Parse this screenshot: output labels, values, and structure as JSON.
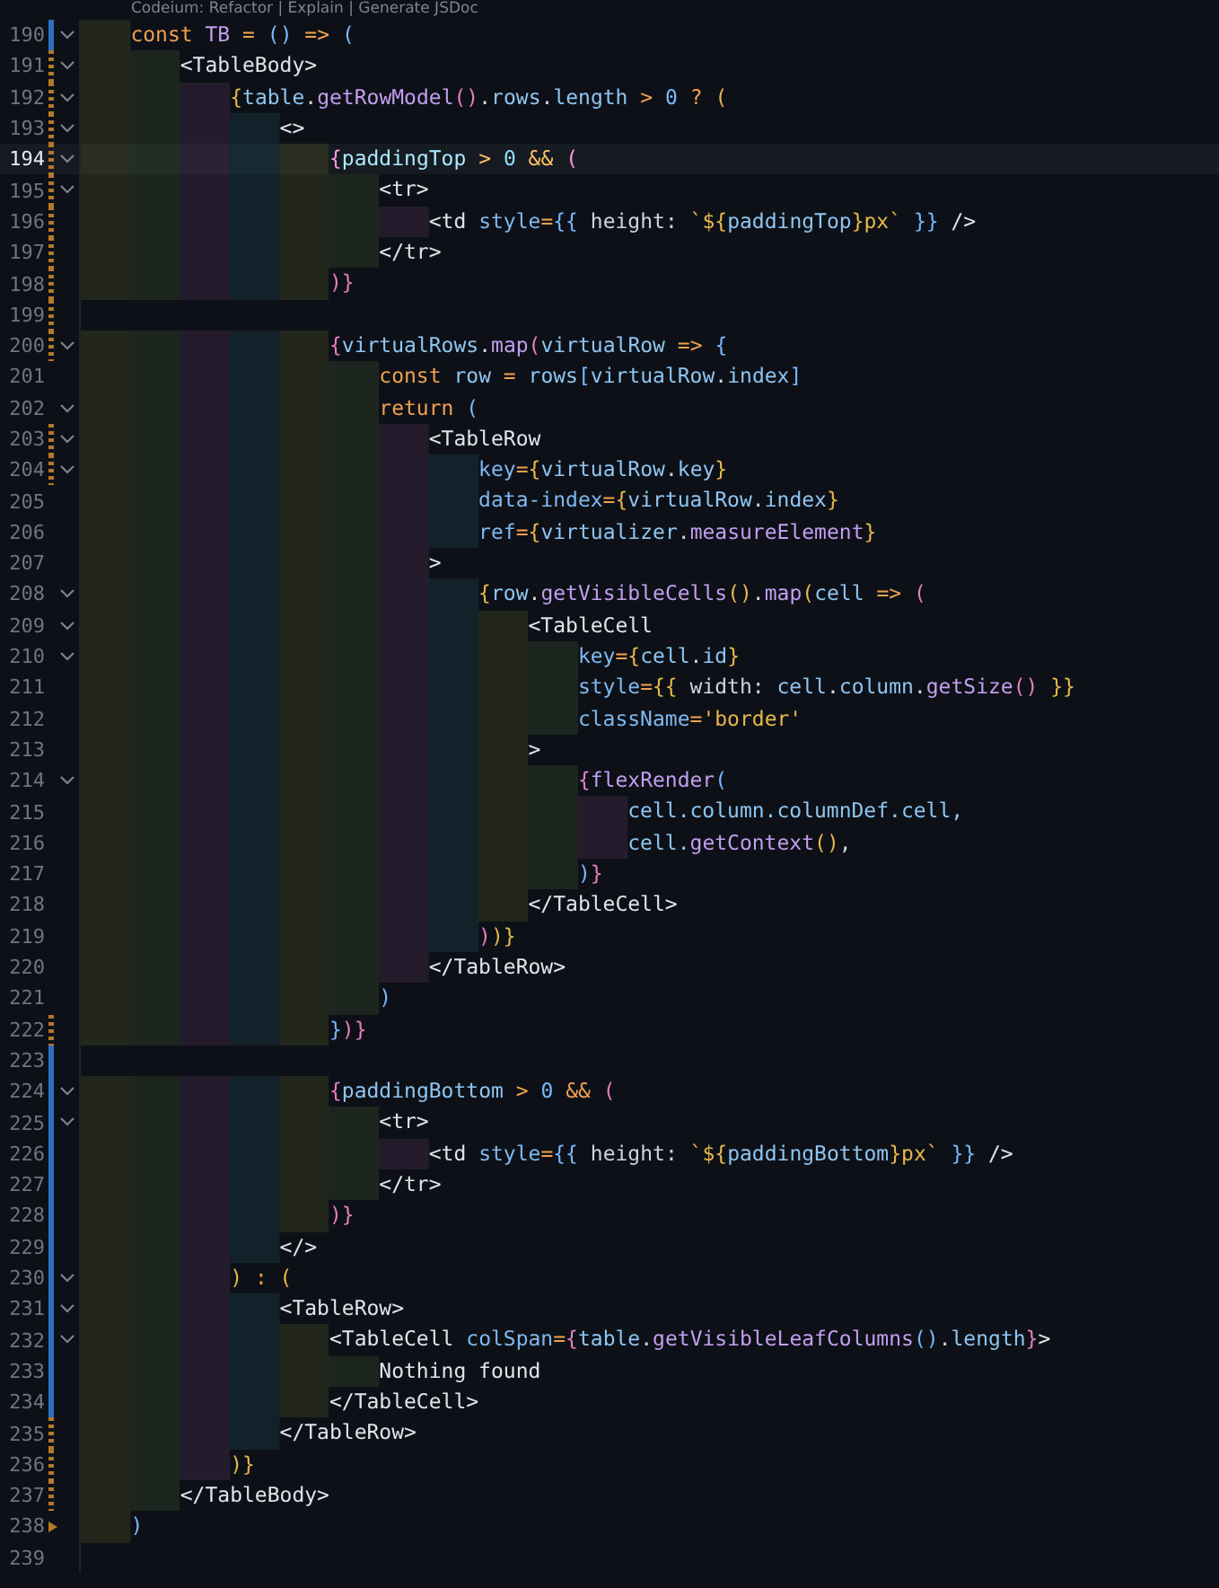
{
  "code_lens": "Codeium: Refactor | Explain | Generate JSDoc",
  "lines": [
    {
      "number": "190",
      "current": false,
      "foldable": true,
      "kind": "modified",
      "tokens": [
        {
          "kind": "kw",
          "text": "    const "
        },
        {
          "kind": "fn",
          "text": "TB"
        },
        {
          "kind": "op",
          "text": " = "
        },
        {
          "kind": "b3",
          "text": "()"
        },
        {
          "kind": "op",
          "text": " => "
        },
        {
          "kind": "b3",
          "text": "("
        }
      ]
    },
    {
      "number": "191",
      "current": false,
      "foldable": true,
      "kind": "changed",
      "tokens": [
        {
          "kind": "tag",
          "text": "        <TableBody>"
        }
      ]
    },
    {
      "number": "192",
      "current": false,
      "foldable": true,
      "kind": "changed",
      "tokens": [
        {
          "kind": "b1",
          "text": "            {"
        },
        {
          "kind": "id",
          "text": "table"
        },
        {
          "kind": "punc",
          "text": "."
        },
        {
          "kind": "fn",
          "text": "getRowModel"
        },
        {
          "kind": "b2",
          "text": "()"
        },
        {
          "kind": "punc",
          "text": "."
        },
        {
          "kind": "id",
          "text": "rows"
        },
        {
          "kind": "punc",
          "text": "."
        },
        {
          "kind": "id",
          "text": "length"
        },
        {
          "kind": "op",
          "text": " > "
        },
        {
          "kind": "num",
          "text": "0"
        },
        {
          "kind": "op",
          "text": " ? "
        },
        {
          "kind": "b1",
          "text": "("
        }
      ]
    },
    {
      "number": "193",
      "current": false,
      "foldable": true,
      "kind": "changed",
      "tokens": [
        {
          "kind": "tag",
          "text": "                <>"
        }
      ]
    },
    {
      "number": "194",
      "current": true,
      "foldable": true,
      "kind": "changed",
      "tokens": [
        {
          "kind": "b2",
          "text": "                    {"
        },
        {
          "kind": "id",
          "text": "paddingTop"
        },
        {
          "kind": "op",
          "text": " > "
        },
        {
          "kind": "num",
          "text": "0"
        },
        {
          "kind": "op",
          "text": " && "
        },
        {
          "kind": "b2",
          "text": "("
        }
      ]
    },
    {
      "number": "195",
      "current": false,
      "foldable": true,
      "kind": "changed",
      "tokens": [
        {
          "kind": "tag",
          "text": "                        <tr>"
        }
      ]
    },
    {
      "number": "196",
      "current": false,
      "foldable": false,
      "kind": "changed",
      "tokens": [
        {
          "kind": "tag",
          "text": "                            <td "
        },
        {
          "kind": "attr",
          "text": "style"
        },
        {
          "kind": "op",
          "text": "="
        },
        {
          "kind": "b3",
          "text": "{{"
        },
        {
          "kind": "punc",
          "text": " height: "
        },
        {
          "kind": "str",
          "text": "`${"
        },
        {
          "kind": "id",
          "text": "paddingTop"
        },
        {
          "kind": "str",
          "text": "}px`"
        },
        {
          "kind": "b3",
          "text": " }}"
        },
        {
          "kind": "tag",
          "text": " />"
        }
      ]
    },
    {
      "number": "197",
      "current": false,
      "foldable": false,
      "kind": "changed",
      "tokens": [
        {
          "kind": "tag",
          "text": "                        </tr>"
        }
      ]
    },
    {
      "number": "198",
      "current": false,
      "foldable": false,
      "kind": "changed",
      "tokens": [
        {
          "kind": "b2",
          "text": "                    )}"
        }
      ]
    },
    {
      "number": "199",
      "current": false,
      "foldable": false,
      "kind": "changed"
    },
    {
      "number": "200",
      "current": false,
      "foldable": true,
      "kind": "changed",
      "tokens": [
        {
          "kind": "b2",
          "text": "                    {"
        },
        {
          "kind": "id",
          "text": "virtualRows"
        },
        {
          "kind": "punc",
          "text": "."
        },
        {
          "kind": "fn",
          "text": "map"
        },
        {
          "kind": "b2",
          "text": "("
        },
        {
          "kind": "id",
          "text": "virtualRow"
        },
        {
          "kind": "op",
          "text": " => "
        },
        {
          "kind": "b3",
          "text": "{"
        }
      ]
    },
    {
      "number": "201",
      "current": false,
      "foldable": false,
      "kind": "plain",
      "tokens": [
        {
          "kind": "kw",
          "text": "                        const "
        },
        {
          "kind": "id",
          "text": "row"
        },
        {
          "kind": "op",
          "text": " = "
        },
        {
          "kind": "id",
          "text": "rows"
        },
        {
          "kind": "b3",
          "text": "["
        },
        {
          "kind": "id",
          "text": "virtualRow"
        },
        {
          "kind": "punc",
          "text": "."
        },
        {
          "kind": "id",
          "text": "index"
        },
        {
          "kind": "b3",
          "text": "]"
        }
      ]
    },
    {
      "number": "202",
      "current": false,
      "foldable": true,
      "kind": "plain",
      "tokens": [
        {
          "kind": "kw",
          "text": "                        return "
        },
        {
          "kind": "b3",
          "text": "("
        }
      ]
    },
    {
      "number": "203",
      "current": false,
      "foldable": true,
      "kind": "changed",
      "tokens": [
        {
          "kind": "tag",
          "text": "                            <TableRow"
        }
      ]
    },
    {
      "number": "204",
      "current": false,
      "foldable": true,
      "kind": "changed",
      "tokens": [
        {
          "kind": "attr",
          "text": "                                key"
        },
        {
          "kind": "op",
          "text": "="
        },
        {
          "kind": "b1",
          "text": "{"
        },
        {
          "kind": "id",
          "text": "virtualRow"
        },
        {
          "kind": "punc",
          "text": "."
        },
        {
          "kind": "id",
          "text": "key"
        },
        {
          "kind": "b1",
          "text": "}"
        }
      ]
    },
    {
      "number": "205",
      "current": false,
      "foldable": false,
      "kind": "plain",
      "tokens": [
        {
          "kind": "attr",
          "text": "                                data-index"
        },
        {
          "kind": "op",
          "text": "="
        },
        {
          "kind": "b1",
          "text": "{"
        },
        {
          "kind": "id",
          "text": "virtualRow"
        },
        {
          "kind": "punc",
          "text": "."
        },
        {
          "kind": "id",
          "text": "index"
        },
        {
          "kind": "b1",
          "text": "}"
        }
      ]
    },
    {
      "number": "206",
      "current": false,
      "foldable": false,
      "kind": "plain",
      "tokens": [
        {
          "kind": "attr",
          "text": "                                ref"
        },
        {
          "kind": "op",
          "text": "="
        },
        {
          "kind": "b1",
          "text": "{"
        },
        {
          "kind": "id",
          "text": "virtualizer"
        },
        {
          "kind": "punc",
          "text": "."
        },
        {
          "kind": "fn",
          "text": "measureElement"
        },
        {
          "kind": "b1",
          "text": "}"
        }
      ]
    },
    {
      "number": "207",
      "current": false,
      "foldable": false,
      "kind": "plain",
      "tokens": [
        {
          "kind": "tag",
          "text": "                            >"
        }
      ]
    },
    {
      "number": "208",
      "current": false,
      "foldable": true,
      "kind": "plain",
      "tokens": [
        {
          "kind": "b1",
          "text": "                                {"
        },
        {
          "kind": "id",
          "text": "row"
        },
        {
          "kind": "punc",
          "text": "."
        },
        {
          "kind": "fn",
          "text": "getVisibleCells"
        },
        {
          "kind": "b1",
          "text": "()"
        },
        {
          "kind": "punc",
          "text": "."
        },
        {
          "kind": "fn",
          "text": "map"
        },
        {
          "kind": "b1",
          "text": "("
        },
        {
          "kind": "id",
          "text": "cell"
        },
        {
          "kind": "op",
          "text": " => "
        },
        {
          "kind": "b2",
          "text": "("
        }
      ]
    },
    {
      "number": "209",
      "current": false,
      "foldable": true,
      "kind": "plain",
      "tokens": [
        {
          "kind": "tag",
          "text": "                                    <TableCell"
        }
      ]
    },
    {
      "number": "210",
      "current": false,
      "foldable": true,
      "kind": "plain",
      "tokens": [
        {
          "kind": "attr",
          "text": "                                        key"
        },
        {
          "kind": "op",
          "text": "="
        },
        {
          "kind": "b1",
          "text": "{"
        },
        {
          "kind": "id",
          "text": "cell"
        },
        {
          "kind": "punc",
          "text": "."
        },
        {
          "kind": "id",
          "text": "id"
        },
        {
          "kind": "b1",
          "text": "}"
        }
      ]
    },
    {
      "number": "211",
      "current": false,
      "foldable": false,
      "kind": "plain",
      "tokens": [
        {
          "kind": "attr",
          "text": "                                        style"
        },
        {
          "kind": "op",
          "text": "="
        },
        {
          "kind": "b1",
          "text": "{{"
        },
        {
          "kind": "punc",
          "text": " width: "
        },
        {
          "kind": "id",
          "text": "cell"
        },
        {
          "kind": "punc",
          "text": "."
        },
        {
          "kind": "id",
          "text": "column"
        },
        {
          "kind": "punc",
          "text": "."
        },
        {
          "kind": "fn",
          "text": "getSize"
        },
        {
          "kind": "b2",
          "text": "()"
        },
        {
          "kind": "b1",
          "text": " }}"
        }
      ]
    },
    {
      "number": "212",
      "current": false,
      "foldable": false,
      "kind": "plain",
      "tokens": [
        {
          "kind": "attr",
          "text": "                                        className"
        },
        {
          "kind": "op",
          "text": "="
        },
        {
          "kind": "str",
          "text": "'border'"
        }
      ]
    },
    {
      "number": "213",
      "current": false,
      "foldable": false,
      "kind": "plain",
      "tokens": [
        {
          "kind": "tag",
          "text": "                                    >"
        }
      ]
    },
    {
      "number": "214",
      "current": false,
      "foldable": true,
      "kind": "plain",
      "tokens": [
        {
          "kind": "b2",
          "text": "                                        {"
        },
        {
          "kind": "fn",
          "text": "flexRender"
        },
        {
          "kind": "b3",
          "text": "("
        }
      ]
    },
    {
      "number": "215",
      "current": false,
      "foldable": false,
      "kind": "plain",
      "tokens": [
        {
          "kind": "id",
          "text": "                                            cell.column.columnDef.cell,"
        }
      ]
    },
    {
      "number": "216",
      "current": false,
      "foldable": false,
      "kind": "plain",
      "tokens": [
        {
          "kind": "id",
          "text": "                                            cell."
        },
        {
          "kind": "fn",
          "text": "getContext"
        },
        {
          "kind": "b1",
          "text": "()"
        },
        {
          "kind": "punc",
          "text": ","
        }
      ]
    },
    {
      "number": "217",
      "current": false,
      "foldable": false,
      "kind": "plain",
      "tokens": [
        {
          "kind": "b3",
          "text": "                                        )"
        },
        {
          "kind": "b2",
          "text": "}"
        }
      ]
    },
    {
      "number": "218",
      "current": false,
      "foldable": false,
      "kind": "plain",
      "tokens": [
        {
          "kind": "tag",
          "text": "                                    </TableCell>"
        }
      ]
    },
    {
      "number": "219",
      "current": false,
      "foldable": false,
      "kind": "plain",
      "tokens": [
        {
          "kind": "b2",
          "text": "                                )"
        },
        {
          "kind": "b1",
          "text": ")}"
        }
      ]
    },
    {
      "number": "220",
      "current": false,
      "foldable": false,
      "kind": "plain",
      "tokens": [
        {
          "kind": "tag",
          "text": "                            </TableRow>"
        }
      ]
    },
    {
      "number": "221",
      "current": false,
      "foldable": false,
      "kind": "plain",
      "tokens": [
        {
          "kind": "b3",
          "text": "                        )"
        }
      ]
    },
    {
      "number": "222",
      "current": false,
      "foldable": false,
      "kind": "changed",
      "tokens": [
        {
          "kind": "b3",
          "text": "                    }"
        },
        {
          "kind": "b2",
          "text": ")}"
        }
      ]
    },
    {
      "number": "223",
      "current": false,
      "foldable": false,
      "kind": "modified"
    },
    {
      "number": "224",
      "current": false,
      "foldable": true,
      "kind": "modified",
      "tokens": [
        {
          "kind": "b2",
          "text": "                    {"
        },
        {
          "kind": "id",
          "text": "paddingBottom"
        },
        {
          "kind": "op",
          "text": " > "
        },
        {
          "kind": "num",
          "text": "0"
        },
        {
          "kind": "op",
          "text": " && "
        },
        {
          "kind": "b2",
          "text": "("
        }
      ]
    },
    {
      "number": "225",
      "current": false,
      "foldable": true,
      "kind": "modified",
      "tokens": [
        {
          "kind": "tag",
          "text": "                        <tr>"
        }
      ]
    },
    {
      "number": "226",
      "current": false,
      "foldable": false,
      "kind": "modified",
      "tokens": [
        {
          "kind": "tag",
          "text": "                            <td "
        },
        {
          "kind": "attr",
          "text": "style"
        },
        {
          "kind": "op",
          "text": "="
        },
        {
          "kind": "b3",
          "text": "{{"
        },
        {
          "kind": "punc",
          "text": " height: "
        },
        {
          "kind": "str",
          "text": "`${"
        },
        {
          "kind": "id",
          "text": "paddingBottom"
        },
        {
          "kind": "str",
          "text": "}px`"
        },
        {
          "kind": "b3",
          "text": " }}"
        },
        {
          "kind": "tag",
          "text": " />"
        }
      ]
    },
    {
      "number": "227",
      "current": false,
      "foldable": false,
      "kind": "modified",
      "tokens": [
        {
          "kind": "tag",
          "text": "                        </tr>"
        }
      ]
    },
    {
      "number": "228",
      "current": false,
      "foldable": false,
      "kind": "modified",
      "tokens": [
        {
          "kind": "b2",
          "text": "                    )}"
        }
      ]
    },
    {
      "number": "229",
      "current": false,
      "foldable": false,
      "kind": "modified",
      "tokens": [
        {
          "kind": "tag",
          "text": "                </>"
        }
      ]
    },
    {
      "number": "230",
      "current": false,
      "foldable": true,
      "kind": "modified",
      "tokens": [
        {
          "kind": "b1",
          "text": "            )"
        },
        {
          "kind": "op",
          "text": " : "
        },
        {
          "kind": "b1",
          "text": "("
        }
      ]
    },
    {
      "number": "231",
      "current": false,
      "foldable": true,
      "kind": "modified",
      "tokens": [
        {
          "kind": "tag",
          "text": "                <TableRow>"
        }
      ]
    },
    {
      "number": "232",
      "current": false,
      "foldable": true,
      "kind": "modified",
      "tokens": [
        {
          "kind": "tag",
          "text": "                    <TableCell "
        },
        {
          "kind": "attr",
          "text": "colSpan"
        },
        {
          "kind": "op",
          "text": "="
        },
        {
          "kind": "b2",
          "text": "{"
        },
        {
          "kind": "id",
          "text": "table"
        },
        {
          "kind": "punc",
          "text": "."
        },
        {
          "kind": "fn",
          "text": "getVisibleLeafColumns"
        },
        {
          "kind": "b3",
          "text": "()"
        },
        {
          "kind": "punc",
          "text": "."
        },
        {
          "kind": "id",
          "text": "length"
        },
        {
          "kind": "b2",
          "text": "}"
        },
        {
          "kind": "tag",
          "text": ">"
        }
      ]
    },
    {
      "number": "233",
      "current": false,
      "foldable": false,
      "kind": "modified",
      "tokens": [
        {
          "kind": "text",
          "text": "                        Nothing found"
        }
      ]
    },
    {
      "number": "234",
      "current": false,
      "foldable": false,
      "kind": "modified",
      "tokens": [
        {
          "kind": "tag",
          "text": "                    </TableCell>"
        }
      ]
    },
    {
      "number": "235",
      "current": false,
      "foldable": false,
      "kind": "changed",
      "tokens": [
        {
          "kind": "tag",
          "text": "                </TableRow>"
        }
      ]
    },
    {
      "number": "236",
      "current": false,
      "foldable": false,
      "kind": "changed",
      "tokens": [
        {
          "kind": "b1",
          "text": "            )}"
        }
      ]
    },
    {
      "number": "237",
      "current": false,
      "foldable": false,
      "kind": "changed",
      "tokens": [
        {
          "kind": "tag",
          "text": "        </TableBody>"
        }
      ]
    },
    {
      "number": "238",
      "current": false,
      "foldable": false,
      "kind": "deleted",
      "tokens": [
        {
          "kind": "b3",
          "text": "    )"
        }
      ]
    },
    {
      "number": "239",
      "current": false,
      "foldable": false,
      "kind": "plain"
    }
  ]
}
